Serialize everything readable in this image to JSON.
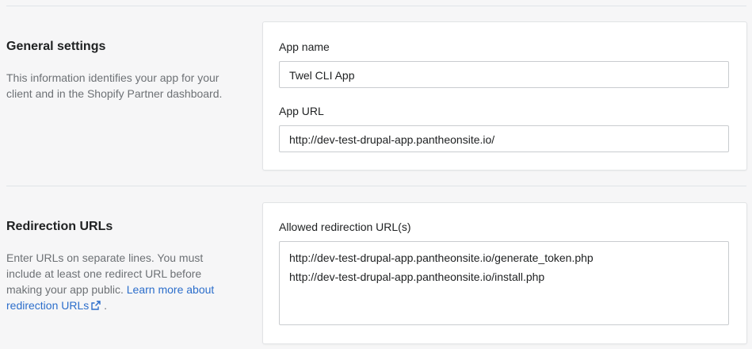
{
  "general": {
    "title": "General settings",
    "description": "This information identifies your app for your client and in the Shopify Partner dashboard.",
    "app_name_label": "App name",
    "app_name_value": "Twel CLI App",
    "app_url_label": "App URL",
    "app_url_value": "http://dev-test-drupal-app.pantheonsite.io/"
  },
  "redirection": {
    "title": "Redirection URLs",
    "description": "Enter URLs on separate lines. You must include at least one redirect URL before making your app public.",
    "learn_more_link": "Learn more about redirection URLs",
    "trailing_period": ".",
    "allowed_label": "Allowed redirection URL(s)",
    "urls": [
      "http://dev-test-drupal-app.pantheonsite.io/generate_token.php",
      "http://dev-test-drupal-app.pantheonsite.io/install.php"
    ]
  },
  "icons": {
    "external_link": "external-link-icon"
  },
  "colors": {
    "link": "#2c6ecb",
    "page_background": "#f6f6f7",
    "card_background": "#ffffff"
  }
}
